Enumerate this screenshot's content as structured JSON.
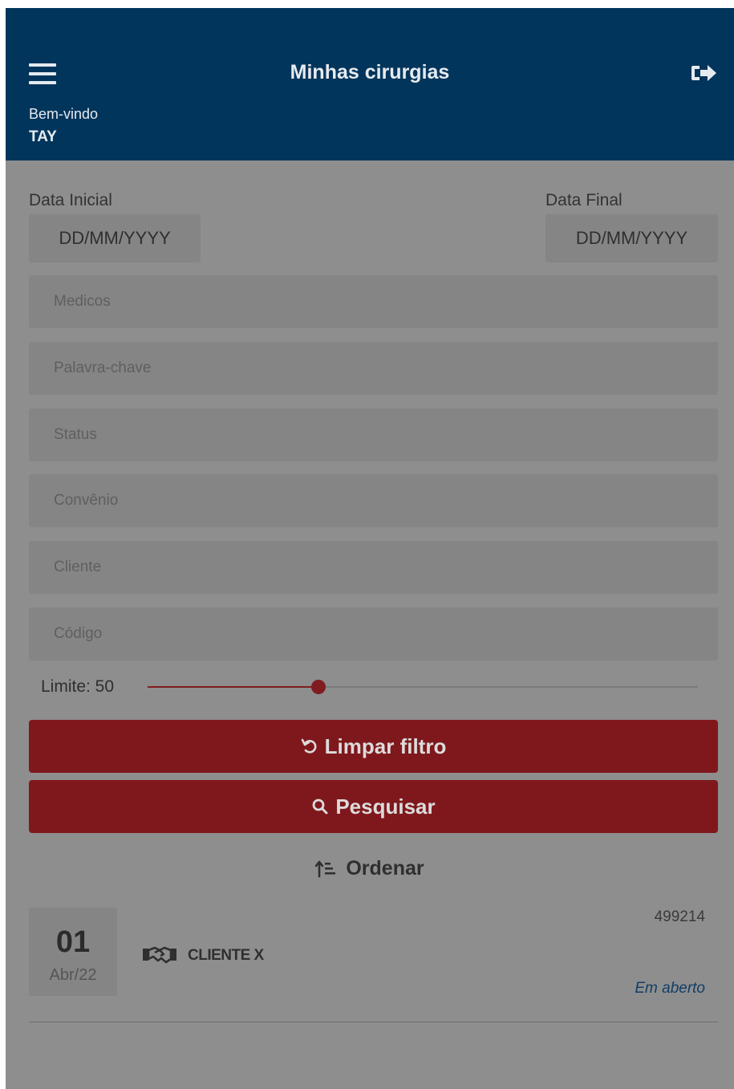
{
  "header": {
    "title": "Minhas cirurgias",
    "welcome": "Bem-vindo",
    "username": "TAY"
  },
  "filters": {
    "date_start_label": "Data Inicial",
    "date_start_value": "DD/MM/YYYY",
    "date_end_label": "Data Final",
    "date_end_value": "DD/MM/YYYY",
    "medicos_placeholder": "Medicos",
    "keyword_placeholder": "Palavra-chave",
    "status_placeholder": "Status",
    "convenio_placeholder": "Convênio",
    "cliente_placeholder": "Cliente",
    "codigo_placeholder": "Código",
    "limit_label": "Limite: 50",
    "limit_fraction": 0.31
  },
  "buttons": {
    "clear_label": "Limpar filtro",
    "search_label": "Pesquisar",
    "order_label": "Ordenar"
  },
  "results": [
    {
      "day": "01",
      "month": "Abr/22",
      "client": "CLIENTE X",
      "code": "499214",
      "status": "Em aberto"
    }
  ],
  "colors": {
    "header": "#02355b",
    "accent": "#7f181c",
    "status": "#123e66"
  }
}
